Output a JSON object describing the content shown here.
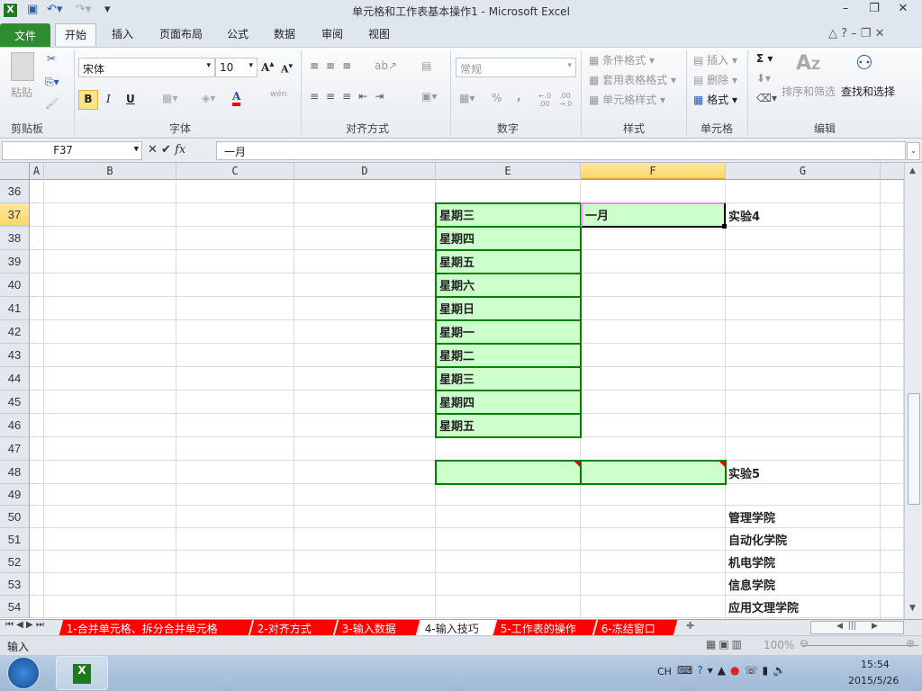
{
  "window": {
    "title": "单元格和工作表基本操作1 - Microsoft Excel"
  },
  "ribbon_tabs": [
    "文件",
    "开始",
    "插入",
    "页面布局",
    "公式",
    "数据",
    "审阅",
    "视图"
  ],
  "clipboard": {
    "paste": "粘贴",
    "group": "剪贴板"
  },
  "font": {
    "name": "宋体",
    "size": "10",
    "bold": "B",
    "italic": "I",
    "underline": "U",
    "color_letter": "A",
    "phonetic": "wén",
    "group": "字体"
  },
  "alignment": {
    "group": "对齐方式"
  },
  "number": {
    "format": "常规",
    "percent": "%",
    "comma": ",",
    "inc": "←.0 .00",
    "dec": ".00 →.0",
    "group": "数字"
  },
  "styles": {
    "conditional": "条件格式",
    "table": "套用表格格式",
    "cell": "单元格样式",
    "group": "样式"
  },
  "cells": {
    "insert": "插入",
    "delete": "删除",
    "format": "格式",
    "group": "单元格"
  },
  "editing": {
    "sum": "Σ",
    "sort": "排序和筛选",
    "find": "查找和选择",
    "group": "编辑"
  },
  "formula_bar": {
    "name_box": "F37",
    "fx": "fx",
    "value": "一月"
  },
  "columns": [
    "A",
    "B",
    "C",
    "D",
    "E",
    "F",
    "G"
  ],
  "rows": [
    "36",
    "37",
    "38",
    "39",
    "40",
    "41",
    "42",
    "43",
    "44",
    "45",
    "46",
    "47",
    "48",
    "49",
    "50",
    "51",
    "52",
    "53",
    "54"
  ],
  "cells_data": {
    "E": [
      "星期三",
      "星期四",
      "星期五",
      "星期六",
      "星期日",
      "星期一",
      "星期二",
      "星期三",
      "星期四",
      "星期五"
    ],
    "F37": "一月",
    "G37": "实验4",
    "G48": "实验5",
    "G50_54": [
      "管理学院",
      "自动化学院",
      "机电学院",
      "信息学院",
      "应用文理学院"
    ]
  },
  "sheet_tabs": [
    {
      "label": "1-合并单元格、拆分合并单元格",
      "active": false
    },
    {
      "label": "2-对齐方式",
      "active": false
    },
    {
      "label": "3-输入数据",
      "active": false
    },
    {
      "label": "4-输入技巧",
      "active": true
    },
    {
      "label": "5-工作表的操作",
      "active": false
    },
    {
      "label": "6-冻结窗口",
      "active": false
    }
  ],
  "status": {
    "mode": "输入",
    "zoom": "100%"
  },
  "taskbar": {
    "lang": "CH",
    "time": "15:54",
    "date": "2015/5/26"
  },
  "colors": {
    "fill": "#ccffcc",
    "border": "#008000",
    "tab_red": "#ff0000",
    "file_tab": "#2f8b2f"
  }
}
